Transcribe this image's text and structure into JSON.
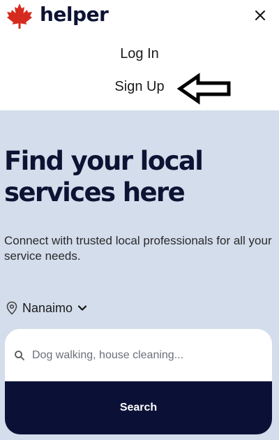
{
  "header": {
    "brand": "helper",
    "logo_icon": "maple-leaf-icon",
    "close_icon": "close-icon",
    "brand_color": "#d52b1e"
  },
  "menu": {
    "login_label": "Log In",
    "signup_label": "Sign Up",
    "pointer_icon": "left-arrow-icon"
  },
  "hero": {
    "title_line1": "Find your local",
    "title_line2": "services here",
    "subtitle": "Connect with trusted local professionals for all your service needs.",
    "background": "#d3ddeb"
  },
  "location": {
    "icon": "map-pin-icon",
    "value": "Nanaimo",
    "dropdown_icon": "chevron-down-icon"
  },
  "search": {
    "icon": "search-icon",
    "placeholder": "Dog walking, house cleaning...",
    "button_label": "Search",
    "button_color": "#0b1136"
  }
}
